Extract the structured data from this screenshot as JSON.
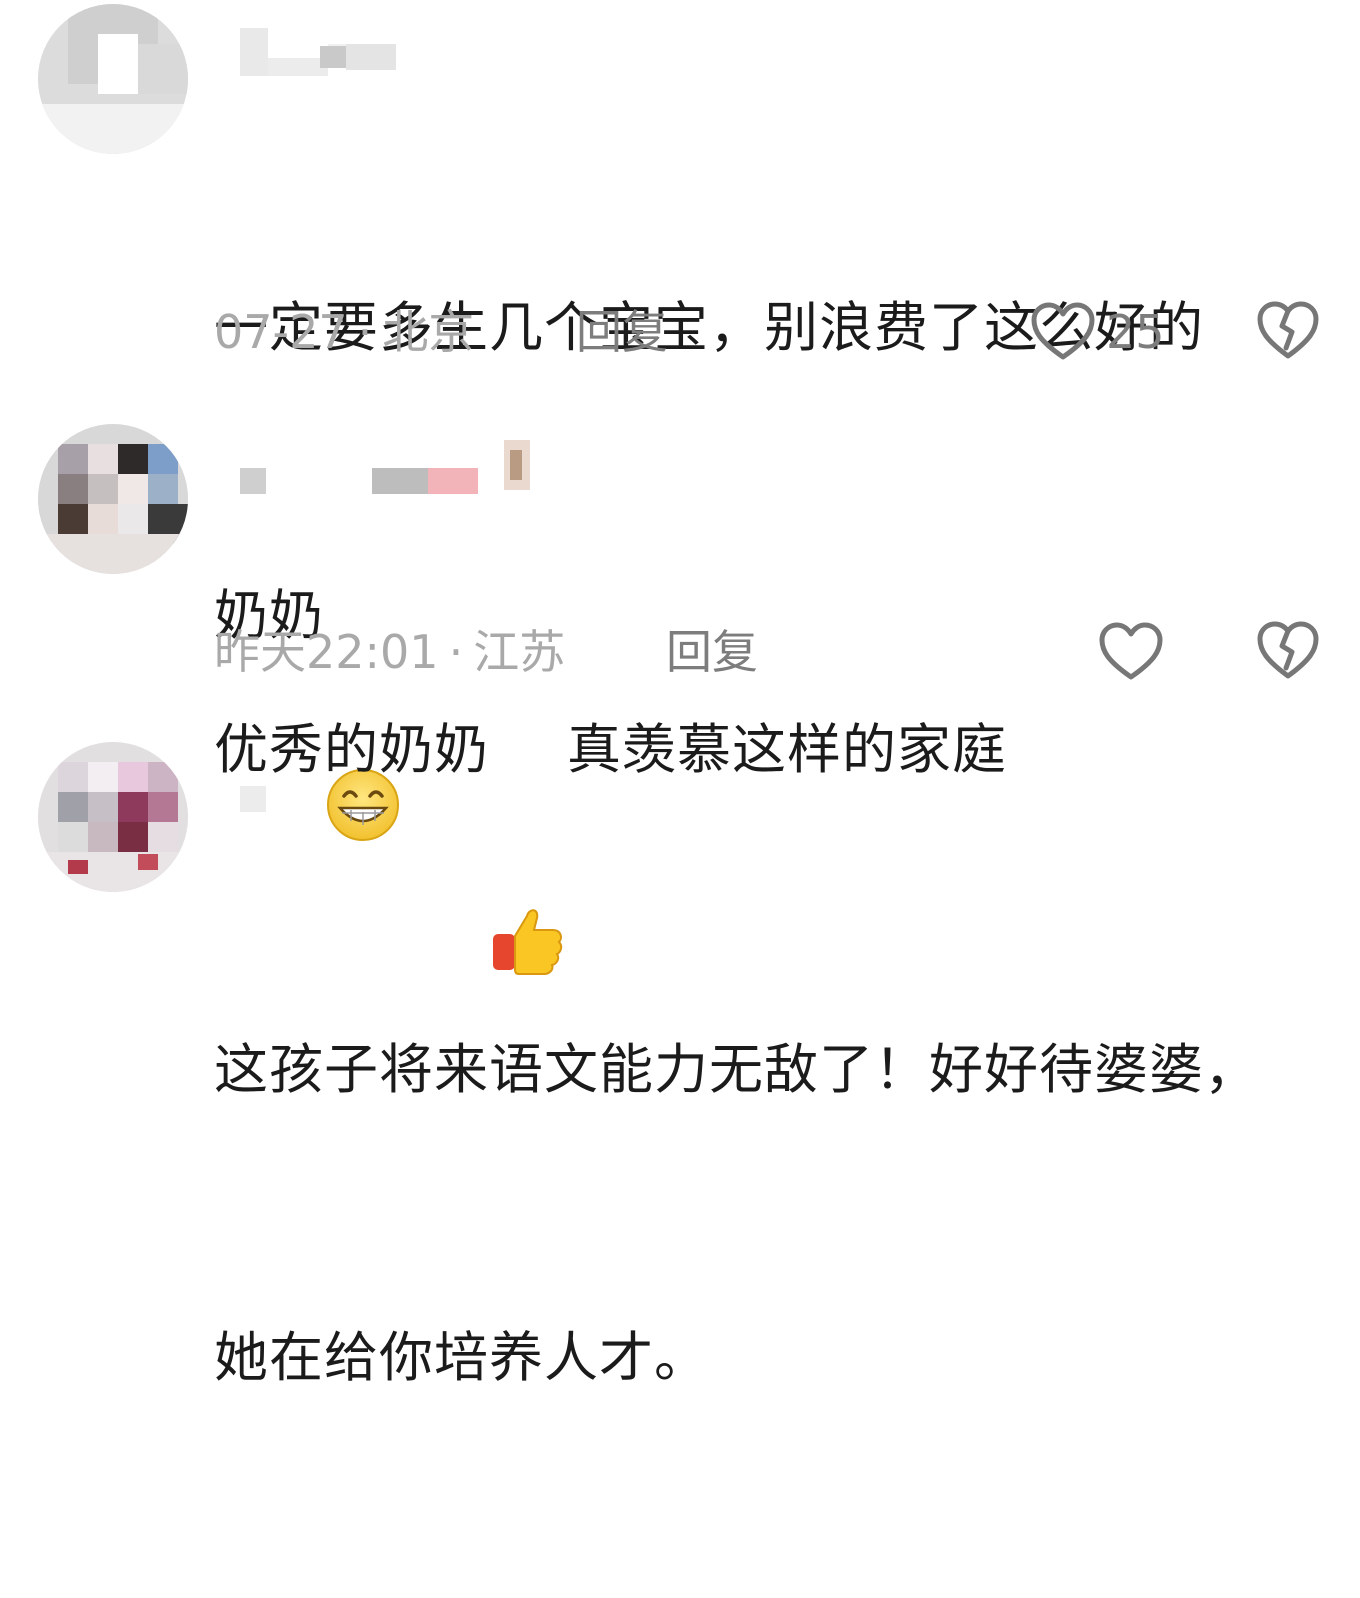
{
  "comments": [
    {
      "text_line1": "一定要多生几个宝宝，别浪费了这么好的",
      "text_line2": "奶奶",
      "emoji": "grinning-emoji",
      "date": "07-27",
      "separator": "·",
      "location": "北京",
      "reply_label": "回复",
      "like_count": "25",
      "icons": {
        "like": "heart-outline-icon",
        "dislike": "broken-heart-icon"
      }
    },
    {
      "text_before": "优秀的奶奶",
      "emoji": "thumbs-up-emoji",
      "text_after": "真羡慕这样的家庭",
      "date": "昨天22:01",
      "separator": "·",
      "location": "江苏",
      "reply_label": "回复",
      "icons": {
        "like": "heart-outline-icon",
        "dislike": "broken-heart-icon"
      }
    },
    {
      "text_line1": "这孩子将来语文能力无敌了！好好待婆婆，",
      "text_line2": "她在给你培养人才。"
    }
  ],
  "colors": {
    "text": "#1b1b1b",
    "meta": "#a9a9a9",
    "reply": "#7d7d7d",
    "icon": "#777777"
  }
}
